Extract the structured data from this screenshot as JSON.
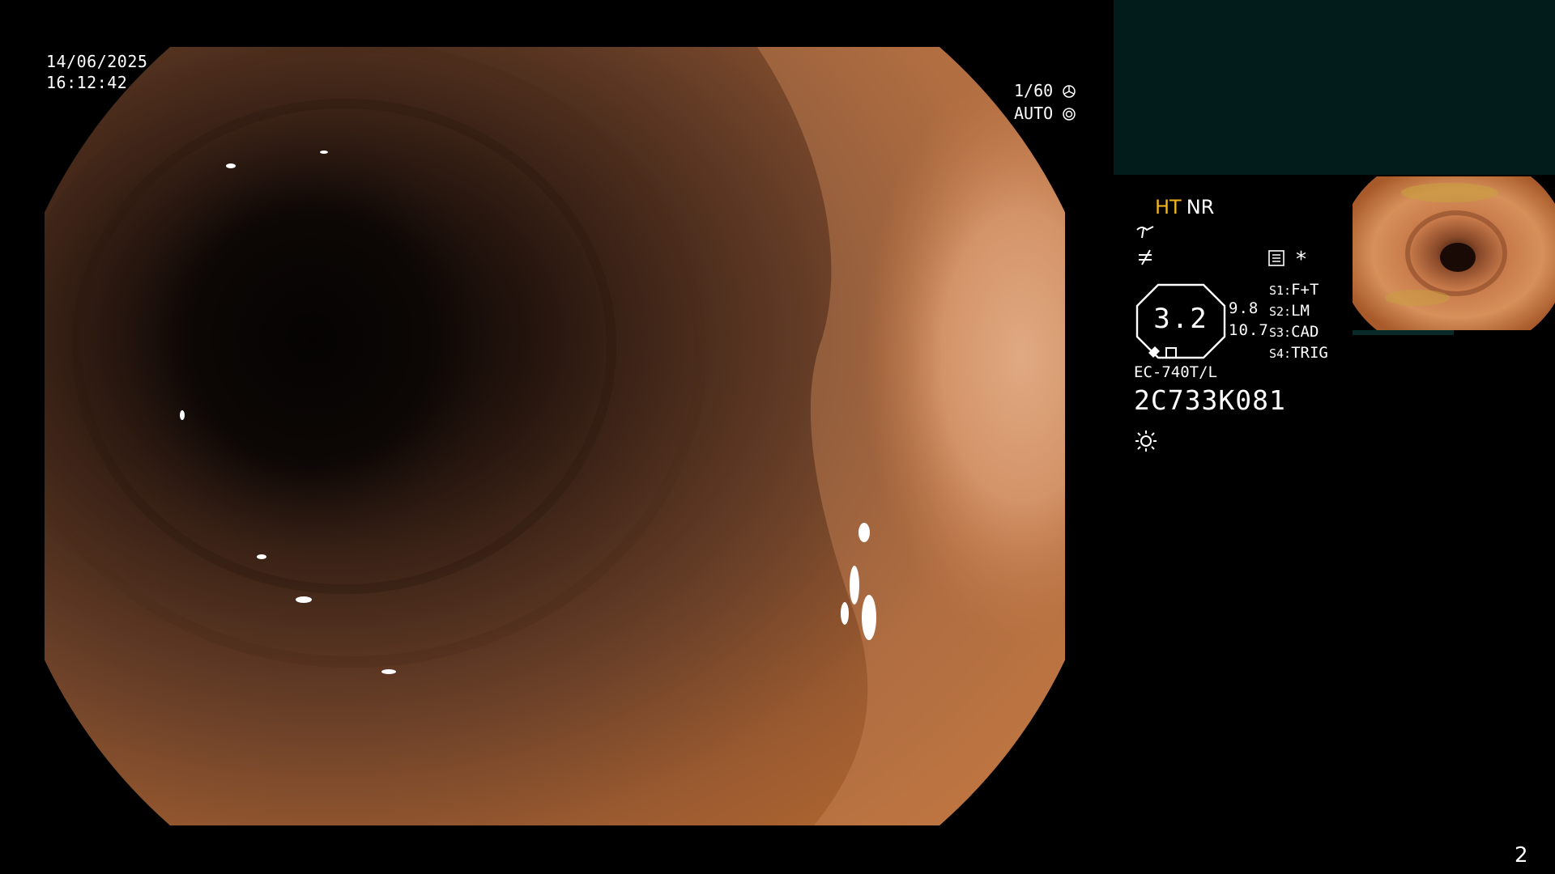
{
  "overlay": {
    "date": "14/06/2025",
    "time": "16:12:42",
    "shutter": "1/60",
    "iris_mode": "AUTO"
  },
  "status": {
    "ht_label": "HT",
    "nr_label": "NR",
    "gauge_value": "3.2",
    "side_value_1": "9.8",
    "side_value_2": "10.7",
    "scope_model": "EC-740T/L",
    "serial_number": "2C733K081",
    "colors": {
      "ht": "#f2b51d",
      "panel": "#021b1b"
    }
  },
  "switches": [
    {
      "key": "S1:",
      "value": "F+T"
    },
    {
      "key": "S2:",
      "value": "LM"
    },
    {
      "key": "S3:",
      "value": "CAD"
    },
    {
      "key": "S4:",
      "value": "TRIG"
    }
  ],
  "icons": [
    "curve-icon",
    "not-equal-icon",
    "memory-icon",
    "asterisk-icon",
    "light-sun-icon",
    "shutter-icon",
    "iris-icon"
  ],
  "page_number": "2"
}
